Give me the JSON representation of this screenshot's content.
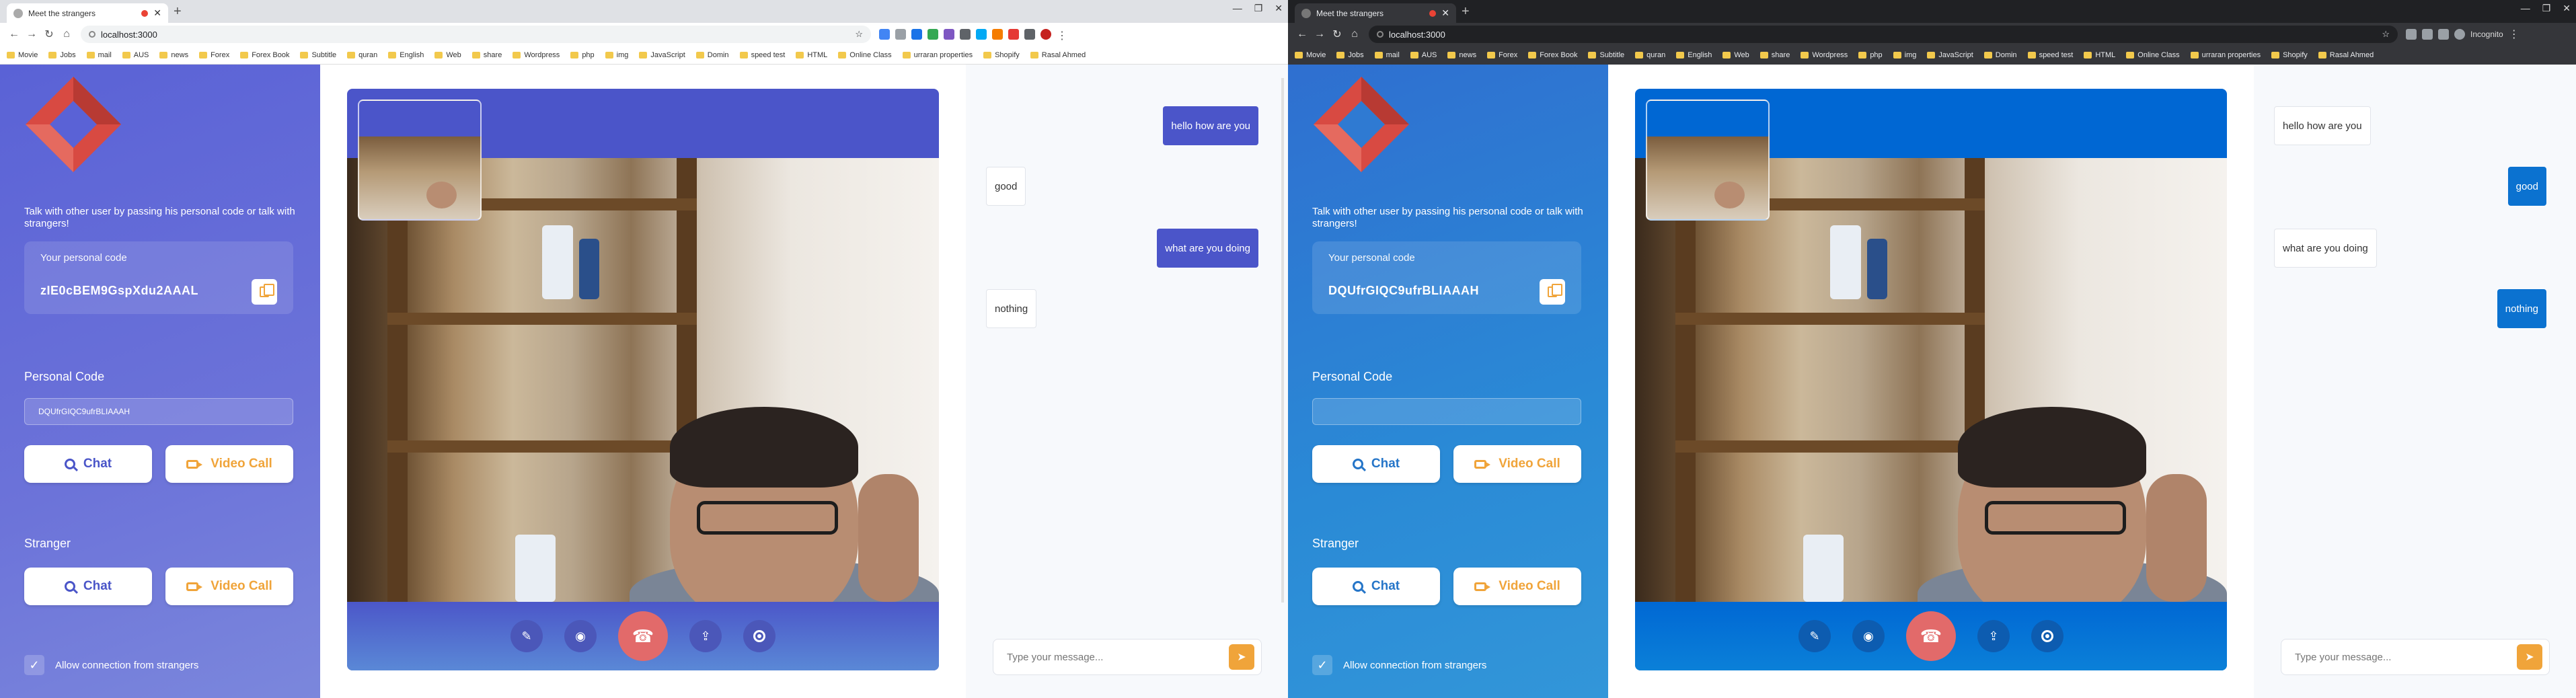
{
  "browser_left": {
    "tab_title": "Meet the strangers",
    "url": "localhost:3000",
    "incognito_label": ""
  },
  "browser_right": {
    "tab_title": "Meet the strangers",
    "url": "localhost:3000",
    "incognito_label": "Incognito"
  },
  "bookmarks": [
    "Movie",
    "Jobs",
    "mail",
    "AUS",
    "news",
    "Forex",
    "Forex Book",
    "Subtitle",
    "quran",
    "English",
    "Web",
    "share",
    "Wordpress",
    "php",
    "img",
    "JavaScript",
    "Domin",
    "speed test",
    "HTML",
    "Online Class",
    "urraran properties",
    "Shopify",
    "Rasal Ahmed"
  ],
  "app": {
    "intro": "Talk with other user by passing his personal code or talk with strangers!",
    "your_code_label": "Your personal code",
    "personal_code_label": "Personal Code",
    "personal_code_placeholder": "",
    "chat_label": "Chat",
    "video_call_label": "Video Call",
    "stranger_label": "Stranger",
    "allow_label": "Allow connection from strangers",
    "message_placeholder": "Type your message..."
  },
  "left": {
    "your_code": "zIE0cBEM9GspXdu2AAAL",
    "personal_code_value": "DQUfrGIQC9ufrBLIAAAH",
    "messages": [
      {
        "text": "hello how are you",
        "from": "me"
      },
      {
        "text": "good",
        "from": "them"
      },
      {
        "text": "what are you doing",
        "from": "me"
      },
      {
        "text": "nothing",
        "from": "them"
      }
    ]
  },
  "right": {
    "your_code": "DQUfrGIQC9ufrBLIAAAH",
    "personal_code_value": "",
    "messages": [
      {
        "text": "hello how are you",
        "from": "them"
      },
      {
        "text": "good",
        "from": "me"
      },
      {
        "text": "what are you doing",
        "from": "them"
      },
      {
        "text": "nothing",
        "from": "me"
      }
    ]
  },
  "controls": [
    "mic-off-icon",
    "camera-icon",
    "hangup-icon",
    "screen-share-icon",
    "record-icon"
  ],
  "colors": {
    "accent_left": "#4b55c9",
    "accent_right": "#0067d3",
    "orange": "#f0a43a",
    "hangup": "#e26a6a"
  }
}
